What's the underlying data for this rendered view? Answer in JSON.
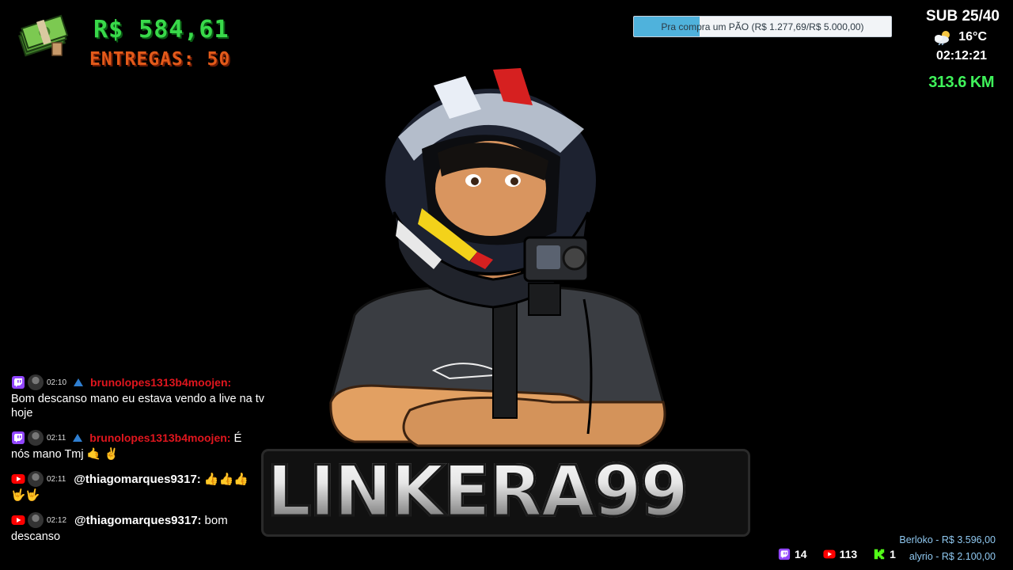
{
  "overlay": {
    "money": {
      "icon": "money-stack-icon",
      "amount": "R$ 584,61",
      "deliveries": "ENTREGAS: 50"
    },
    "goal": {
      "text": "Pra compra um PÃO (R$ 1.277,69/R$ 5.000,00)",
      "progress": 0.2555,
      "fill_color": "#4fb2dc"
    },
    "stats": {
      "subs": "SUB 25/40",
      "weather_icon": "partly-cloudy-icon",
      "temperature": "16°C",
      "clock": "02:12:21",
      "distance": "313.6 KM"
    },
    "logo_text": "LINKERA99"
  },
  "chat": [
    {
      "platform": "twitch-icon",
      "time": "02:10",
      "user": "brunolopes1313b4moojen:",
      "inline": "",
      "text": "Bom descanso mano eu estava vendo a live na tv hoje"
    },
    {
      "platform": "twitch-icon",
      "time": "02:11",
      "user": "brunolopes1313b4moojen:",
      "inline": "É",
      "text": "nós mano Tmj 🤙 ✌"
    },
    {
      "platform": "youtube-icon",
      "time": "02:11",
      "user": "@thiagomarques9317:",
      "inline": "👍👍👍",
      "text": "🤟🤟"
    },
    {
      "platform": "youtube-icon",
      "time": "02:12",
      "user": "@thiagomarques9317:",
      "inline": "bom",
      "text": "descanso"
    }
  ],
  "viewers": [
    {
      "platform": "twitch-icon",
      "count": "14"
    },
    {
      "platform": "youtube-icon",
      "count": "113"
    },
    {
      "platform": "kick-icon",
      "count": "1"
    }
  ],
  "donations": [
    "Berloko - R$ 3.596,00",
    "alyrio - R$ 2.100,00"
  ],
  "colors": {
    "money": "#39d94a",
    "deliveries": "#e35a1a",
    "distance": "#3ff25a",
    "twitch": "#9146ff",
    "youtube": "#ff0000",
    "kick": "#53fc18",
    "chat_user_twitch": "#e0161e"
  }
}
